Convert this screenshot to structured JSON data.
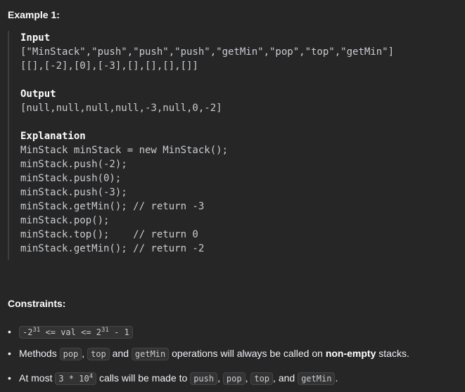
{
  "example": {
    "title": "Example 1:",
    "input_label": "Input",
    "input_line1": "[\"MinStack\",\"push\",\"push\",\"push\",\"getMin\",\"pop\",\"top\",\"getMin\"]",
    "input_line2": "[[],[-2],[0],[-3],[],[],[],[]]",
    "output_label": "Output",
    "output_line": "[null,null,null,null,-3,null,0,-2]",
    "explanation_label": "Explanation",
    "explanation_lines": [
      "MinStack minStack = new MinStack();",
      "minStack.push(-2);",
      "minStack.push(0);",
      "minStack.push(-3);",
      "minStack.getMin(); // return -3",
      "minStack.pop();",
      "minStack.top();    // return 0",
      "minStack.getMin(); // return -2"
    ]
  },
  "constraints": {
    "title": "Constraints:",
    "c1": {
      "base1": "-2",
      "exp1": "31",
      "middle": " <= val <= ",
      "base2": "2",
      "exp2": "31",
      "tail": " - 1"
    },
    "c2": {
      "prefix": "Methods ",
      "pop": "pop",
      "sep1": ", ",
      "top": "top",
      "and": " and ",
      "getMin": "getMin",
      "mid": " operations will always be called on ",
      "bold": "non-empty",
      "suffix": " stacks."
    },
    "c3": {
      "prefix": "At most ",
      "code_base": "3 * 10",
      "code_exp": "4",
      "mid": " calls will be made to ",
      "push": "push",
      "sep1": ", ",
      "pop": "pop",
      "sep2": ", ",
      "top": "top",
      "and": ", and ",
      "getMin": "getMin",
      "suffix": "."
    }
  }
}
